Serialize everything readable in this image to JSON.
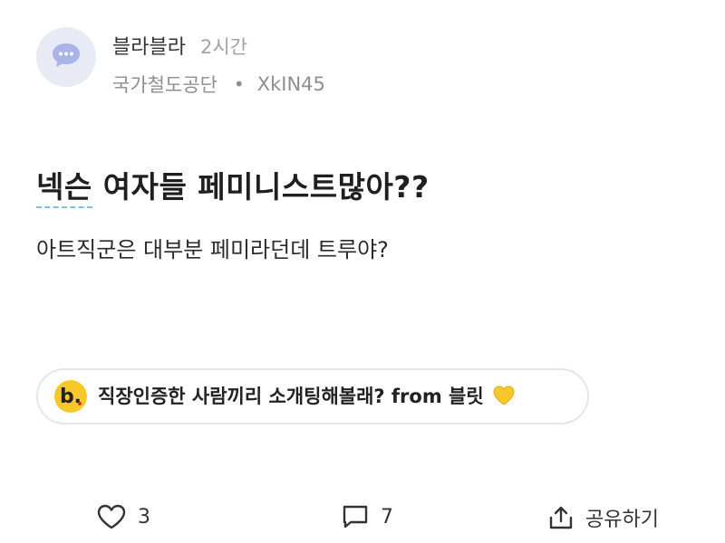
{
  "header": {
    "author": "블라블라",
    "time": "2시간",
    "company": "국가철도공단",
    "separator": "•",
    "user_id": "XkIN45"
  },
  "post": {
    "title_link": "넥슨",
    "title_rest": " 여자들 페미니스트많아??",
    "body": "아트직군은 대부분 페미라던데 트루야?"
  },
  "promo": {
    "logo_letter": "b.",
    "text": "직장인증한 사람끼리 소개팅해볼래? from 블릿"
  },
  "actions": {
    "like_count": "3",
    "comment_count": "7",
    "share_label": "공유하기"
  },
  "colors": {
    "avatar_bg": "#e8ebf6",
    "avatar_icon": "#a9b5e6",
    "promo_logo": "#f7c82a",
    "heart_emoji": "#f7c82a",
    "title_underline": "#7fbfe0"
  },
  "icons": {
    "avatar": "chat-bubble-icon",
    "like": "heart-outline-icon",
    "comment": "comment-icon",
    "share": "share-icon",
    "promo_heart": "yellow-heart-icon"
  }
}
